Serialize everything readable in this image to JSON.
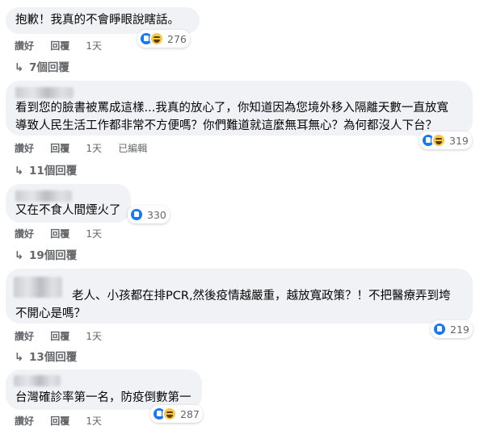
{
  "comments": [
    {
      "lines": [
        "抱歉！我真的不會睜眼說瞎話。"
      ],
      "actions": {
        "like": "讚好",
        "reply": "回覆",
        "time": "1天"
      },
      "reaction_count": "276",
      "reactions": [
        "like-icon",
        "haha-icon"
      ],
      "replies": "7個回覆"
    },
    {
      "lines": [
        "看到您的臉書被罵成這樣...我真的放心了，你知道因為您境外移入隔離天數一直放寬",
        "導致人民生活工作都非常不方便嗎？你們難道就這麼無耳無心？為何都沒人下台？"
      ],
      "actions": {
        "like": "讚好",
        "reply": "回覆",
        "time": "1天",
        "edited": "已編輯"
      },
      "reaction_count": "319",
      "reactions": [
        "like-icon",
        "haha-icon"
      ],
      "replies": "11個回覆"
    },
    {
      "lines": [
        "又在不食人間煙火了"
      ],
      "actions": {
        "like": "讚好",
        "reply": "回覆",
        "time": "1天"
      },
      "reaction_count": "330",
      "reactions": [
        "like-icon"
      ],
      "replies": "19個回覆"
    },
    {
      "lines": [
        "老人、小孩都在排PCR,然後疫情越嚴重，越放寬政策？！不把醫療弄到垮",
        "不開心是嗎？"
      ],
      "actions": {
        "like": "讚好",
        "reply": "回覆",
        "time": "1天"
      },
      "reaction_count": "219",
      "reactions": [
        "like-icon"
      ],
      "replies": "13個回覆"
    },
    {
      "lines": [
        "台灣確診率第一名，防疫倒數第一"
      ],
      "actions": {
        "like": "讚好",
        "reply": "回覆",
        "time": "1天"
      },
      "reaction_count": "287",
      "reactions": [
        "like-icon",
        "haha-icon"
      ]
    }
  ],
  "colors": {
    "bubble": "#f0f2f5",
    "like": "#1877f2",
    "haha": "#f7c84a",
    "meta": "#65676b"
  }
}
